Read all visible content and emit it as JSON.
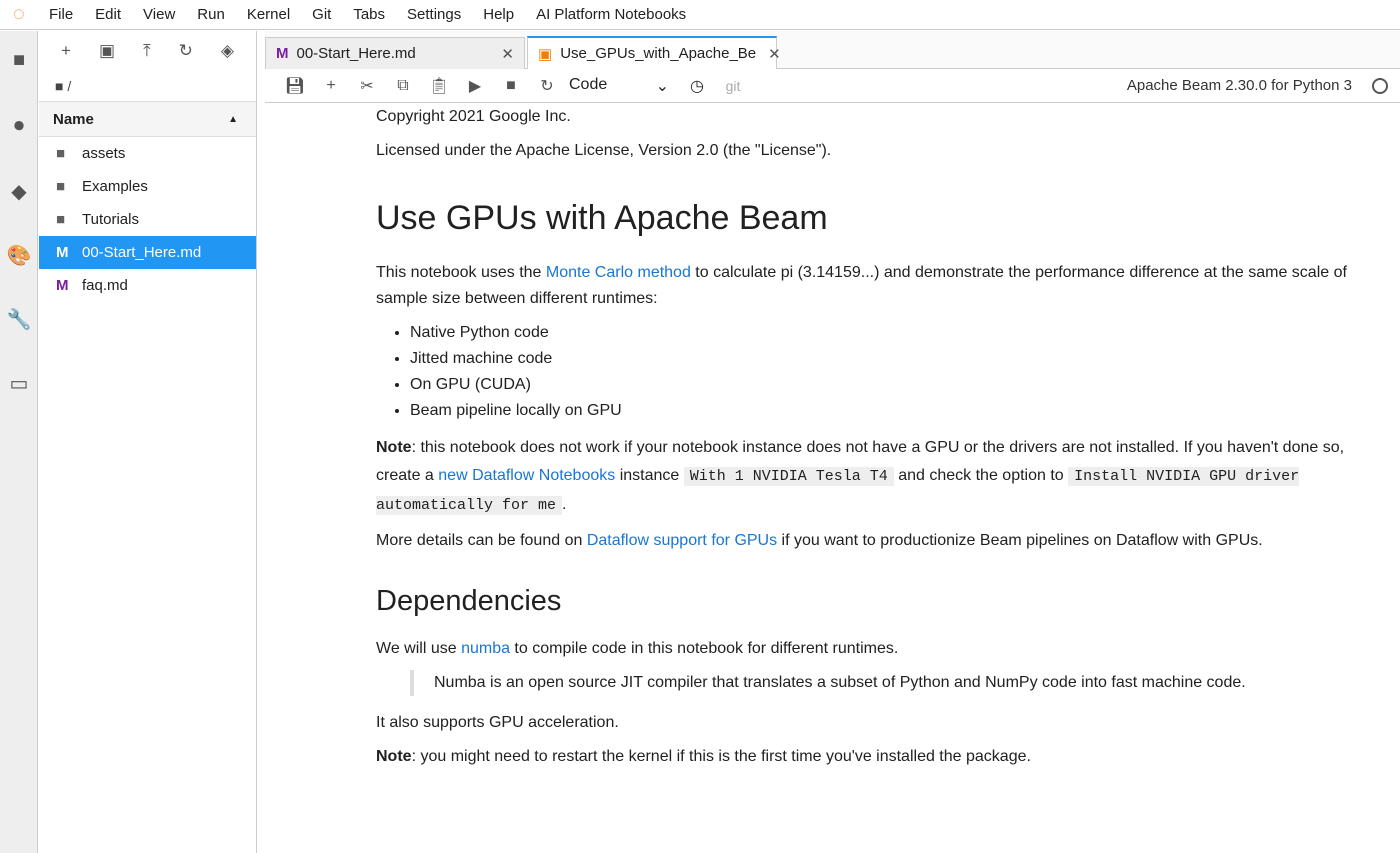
{
  "menu": [
    "File",
    "Edit",
    "View",
    "Run",
    "Kernel",
    "Git",
    "Tabs",
    "Settings",
    "Help",
    "AI Platform Notebooks"
  ],
  "filebrowser": {
    "path": "/",
    "column": "Name",
    "items": [
      {
        "name": "assets",
        "type": "folder"
      },
      {
        "name": "Examples",
        "type": "folder"
      },
      {
        "name": "Tutorials",
        "type": "folder"
      },
      {
        "name": "00-Start_Here.md",
        "type": "md"
      },
      {
        "name": "faq.md",
        "type": "md"
      }
    ]
  },
  "tabs": [
    {
      "label": "00-Start_Here.md"
    },
    {
      "label": "Use_GPUs_with_Apache_Be"
    }
  ],
  "toolbar": {
    "cell_type": "Code",
    "git": "git",
    "kernel": "Apache Beam 2.30.0 for Python 3"
  },
  "content": {
    "copyright": "Copyright 2021 Google Inc.",
    "license": "Licensed under the Apache License, Version 2.0 (the \"License\").",
    "h1": "Use GPUs with Apache Beam",
    "intro_a": "This notebook uses the ",
    "intro_link": "Monte Carlo method",
    "intro_b": " to calculate pi (3.14159...) and demonstrate the performance difference at the same scale of sample size between different runtimes:",
    "bullets": [
      "Native Python code",
      "Jitted machine code",
      "On GPU (CUDA)",
      "Beam pipeline locally on GPU"
    ],
    "note_label": "Note",
    "note_a": ": this notebook does not work if your notebook instance does not have a GPU or the drivers are not installed. If you haven't done so, create a ",
    "note_link": "new Dataflow Notebooks",
    "note_b": " instance ",
    "note_code1": "With 1 NVIDIA Tesla T4",
    "note_c": " and check the option to ",
    "note_code2": "Install NVIDIA GPU driver automatically for me",
    "note_d": ".",
    "more_a": "More details can be found on ",
    "more_link": "Dataflow support for GPUs",
    "more_b": " if you want to productionize Beam pipelines on Dataflow with GPUs.",
    "h2": "Dependencies",
    "dep_a": "We will use ",
    "dep_link": "numba",
    "dep_b": " to compile code in this notebook for different runtimes.",
    "quote": "Numba is an open source JIT compiler that translates a subset of Python and NumPy code into fast machine code.",
    "gpu": "It also supports GPU acceleration.",
    "note2_label": "Note",
    "note2": ": you might need to restart the kernel if this is the first time you've installed the package."
  }
}
